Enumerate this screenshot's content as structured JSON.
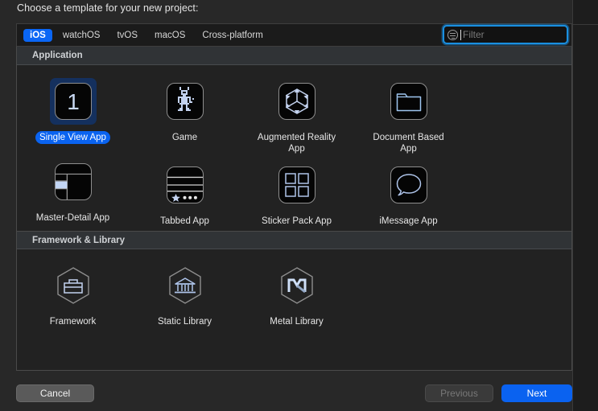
{
  "dialog": {
    "prompt": "Choose a template for your new project:"
  },
  "tabs": [
    {
      "label": "iOS",
      "selected": true
    },
    {
      "label": "watchOS",
      "selected": false
    },
    {
      "label": "tvOS",
      "selected": false
    },
    {
      "label": "macOS",
      "selected": false
    },
    {
      "label": "Cross-platform",
      "selected": false
    }
  ],
  "filter": {
    "placeholder": "Filter",
    "value": "",
    "icon": "filter-lines-circle-icon",
    "focused": true,
    "accent": "#1a8fe0"
  },
  "sections": [
    {
      "title": "Application",
      "items": [
        {
          "label": "Single View App",
          "icon": "number-one-icon",
          "selected": true
        },
        {
          "label": "Game",
          "icon": "pixel-robot-icon",
          "selected": false
        },
        {
          "label": "Augmented Reality App",
          "icon": "ar-cube-icon",
          "selected": false
        },
        {
          "label": "Document Based App",
          "icon": "folder-icon",
          "selected": false
        },
        {
          "label": "Master-Detail App",
          "icon": "split-view-icon",
          "selected": false
        },
        {
          "label": "Tabbed App",
          "icon": "tab-bar-icon",
          "selected": false
        },
        {
          "label": "Sticker Pack App",
          "icon": "four-squares-icon",
          "selected": false
        },
        {
          "label": "iMessage App",
          "icon": "speech-bubble-icon",
          "selected": false
        }
      ]
    },
    {
      "title": "Framework & Library",
      "items": [
        {
          "label": "Framework",
          "icon": "briefcase-hexagon-icon",
          "selected": false
        },
        {
          "label": "Static Library",
          "icon": "bank-hexagon-icon",
          "selected": false
        },
        {
          "label": "Metal Library",
          "icon": "metal-m-hexagon-icon",
          "selected": false
        }
      ]
    }
  ],
  "buttons": {
    "cancel": "Cancel",
    "previous": "Previous",
    "next": "Next",
    "previous_disabled": true,
    "next_accent": "#0a62f0"
  }
}
